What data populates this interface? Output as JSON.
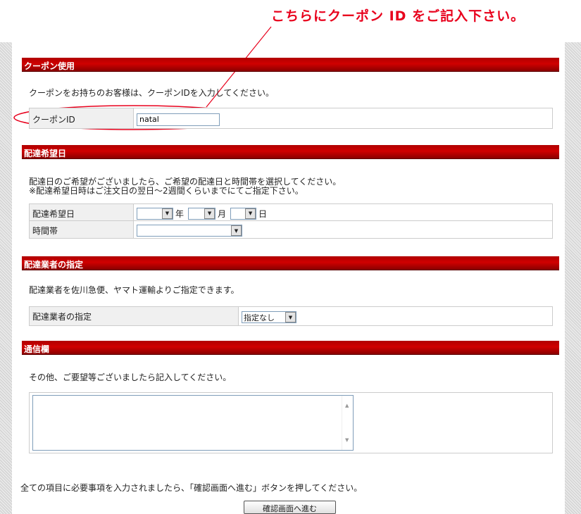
{
  "annotation": {
    "text": "こちらにクーポン ID をご記入下さい。"
  },
  "coupon": {
    "header": "クーポン使用",
    "description": "クーポンをお持ちのお客様は、クーポンIDを入力してください。",
    "label": "クーポンID",
    "value": "natal"
  },
  "delivery_date": {
    "header": "配達希望日",
    "description_1": "配達日のご希望がございましたら、ご希望の配達日と時間帯を選択してください。",
    "description_2": "※配達希望日時はご注文日の翌日〜2週間くらいまでにてご指定下さい。",
    "date_label": "配達希望日",
    "year_suffix": "年",
    "month_suffix": "月",
    "day_suffix": "日",
    "time_label": "時間帯"
  },
  "carrier": {
    "header": "配達業者の指定",
    "description": "配達業者を佐川急便、ヤマト運輸よりご指定できます。",
    "label": "配達業者の指定",
    "selected": "指定なし"
  },
  "message": {
    "header": "通信欄",
    "description": "その他、ご要望等ございましたら記入してください。"
  },
  "footer": {
    "text": "全ての項目に必要事項を入力されましたら、「確認画面へ進む」ボタンを押してください。",
    "submit_label": "確認画面へ進む"
  },
  "colors": {
    "accent": "#e8001c",
    "header": "#b00000"
  }
}
